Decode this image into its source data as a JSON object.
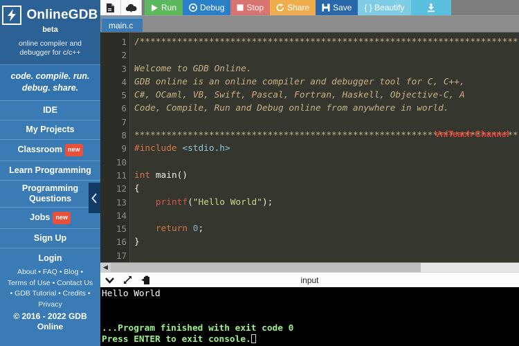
{
  "sidebar": {
    "brand_name": "OnlineGDB",
    "brand_beta": "beta",
    "brand_tagline_1": "online compiler and",
    "brand_tagline_2": "debugger for c/c++",
    "slogan_1": "code. compile. run.",
    "slogan_2": "debug. share.",
    "nav": [
      {
        "label": "IDE",
        "badge": ""
      },
      {
        "label": "My Projects",
        "badge": ""
      },
      {
        "label": "Classroom",
        "badge": "new"
      },
      {
        "label": "Learn Programming",
        "badge": ""
      },
      {
        "label": "Programming Questions",
        "badge": ""
      },
      {
        "label": "Jobs",
        "badge": "new"
      },
      {
        "label": "Sign Up",
        "badge": ""
      }
    ],
    "nav_programming_line1": "Programming",
    "nav_programming_line2": "Questions",
    "login_label": "Login",
    "footer_line_1": "About • FAQ • Blog •",
    "footer_line_2": "Terms of Use • Contact Us",
    "footer_line_3": "• GDB Tutorial • Credits •",
    "footer_line_4": "Privacy",
    "copyright_1": "© 2016 - 2022 GDB",
    "copyright_2": "Online",
    "collapse_icon": "chevron-left-icon",
    "accent_color": "#3a7ab5",
    "brand_dark_color": "#2c6196",
    "badge_color": "#e8503a"
  },
  "toolbar": {
    "new_file_icon": "new-file-icon",
    "open_upload_icon": "upload-cloud-icon",
    "run_label": "Run",
    "debug_label": "Debug",
    "stop_label": "Stop",
    "share_label": "Share",
    "save_label": "Save",
    "beautify_label": "{ } Beautify",
    "download_icon": "download-icon",
    "run_color": "#5cb85c",
    "debug_color": "#2a7fc9",
    "stop_color": "#d9736f",
    "share_color": "#f0ad4e",
    "save_color": "#2767aa",
    "beautify_color": "#7ecde4",
    "download_color": "#5bbfe0"
  },
  "editor": {
    "tab_label": "main.c",
    "line_numbers": [
      "1",
      "2",
      "3",
      "4",
      "5",
      "6",
      "7",
      "8",
      "9",
      "10",
      "11",
      "12",
      "13",
      "14",
      "15",
      "16",
      "17"
    ],
    "watermark": "VniTeach Channel",
    "lines": {
      "l1_stars": "/******************************************************************************",
      "l3": "Welcome to GDB Online.",
      "l4": "GDB online is an online compiler and debugger tool for C, C++,",
      "l5": "C#, OCaml, VB, Swift, Pascal, Fortran, Haskell, Objective-C, A",
      "l6": "Code, Compile, Run and Debug online from anywhere in world.",
      "l8_stars": "*******************************************************************************",
      "l9_pre": "#include",
      "l9_inc": "<stdio.h>",
      "l11_kw": "int",
      "l11_rest": " main()",
      "l12": "{",
      "l13_fn": "printf",
      "l13_open": "(",
      "l13_str": "\"Hello World\"",
      "l13_close": ");",
      "l15_kw": "return",
      "l15_num": "0",
      "l15_semi": ";",
      "l16": "}"
    }
  },
  "console": {
    "bar_label": "input",
    "collapse_icon": "chevron-down-icon",
    "expand_icon": "expand-arrows-icon",
    "copy_icon": "clipboard-icon",
    "output_line_1": "Hello World",
    "output_line_2": "",
    "output_line_3": "",
    "output_line_4": "...Program finished with exit code 0",
    "output_line_5": "Press ENTER to exit console.",
    "output_text_color": "#9bf08a"
  }
}
